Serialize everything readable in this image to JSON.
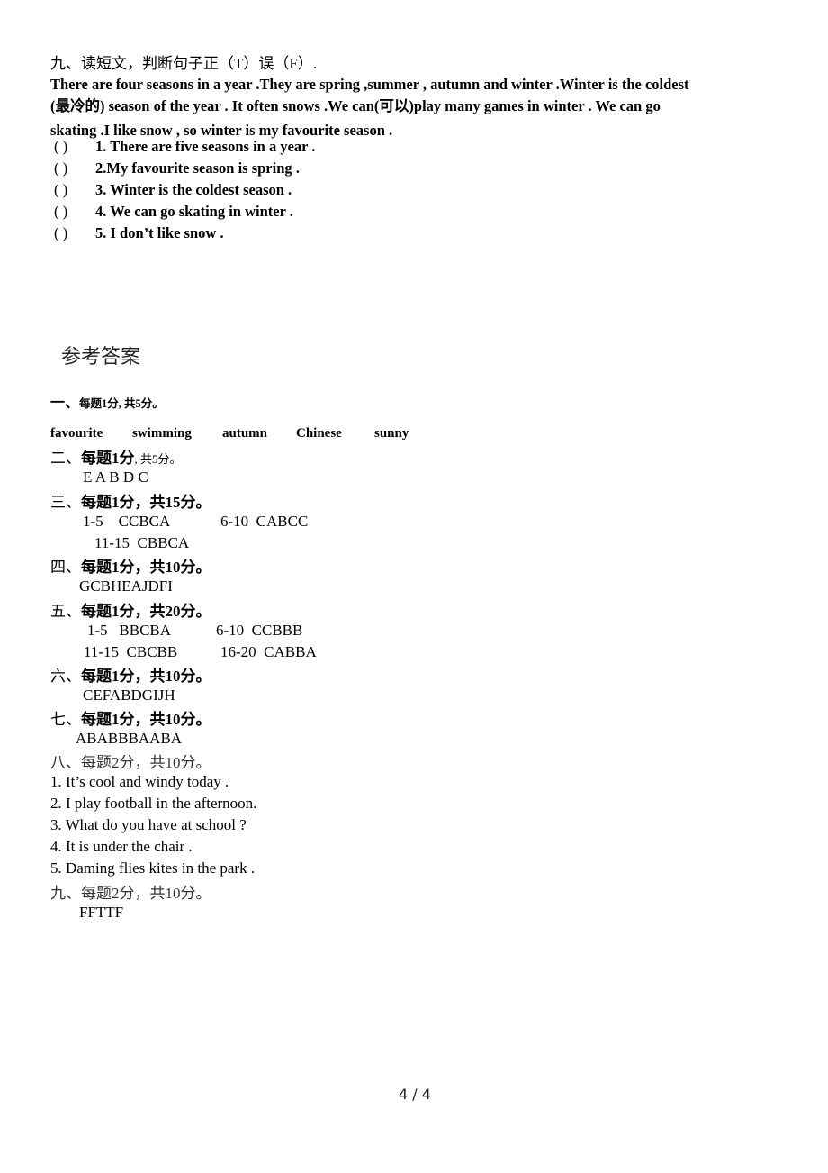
{
  "exercise9": {
    "heading": "九、读短文，判断句子正（T）误（F）.",
    "passage_line1": "There are four seasons in a year .They are spring ,summer , autumn and winter .Winter is the coldest",
    "passage_line2": "(最冷的) season of the year . It often snows .We can(可以)play many games in winter . We can go",
    "passage_line3": "skating .I like snow , so winter is my favourite season .",
    "answer_blank": "(    )",
    "questions": [
      "1. There are five seasons in a year .",
      "2.My favourite season is spring .",
      "3. Winter is the coldest season  .",
      "4. We can go skating in winter .",
      "5. I don’t like snow ."
    ]
  },
  "answer_key": {
    "title": "参考答案",
    "sections": [
      {
        "num": "一、",
        "score": "每题1分, 共5分。",
        "answers": [
          "favourite",
          "swimming",
          "autumn",
          "Chinese",
          "sunny"
        ]
      },
      {
        "num": "二、",
        "score_bold": "每题1分",
        "score_rest": ", 共5分。",
        "answers": [
          "E A B D C"
        ]
      },
      {
        "num": "三、",
        "score": "每题1分，共15分。",
        "answers": [
          "1-5    CCBCA",
          "6-10  CABCC",
          "11-15  CBBCA"
        ]
      },
      {
        "num": "四、",
        "score": "每题1分，共10分。",
        "answers": [
          "GCBHEAJDFI"
        ]
      },
      {
        "num": "五、",
        "score": "每题1分，共20分。",
        "answers": [
          "1-5   BBCBA",
          "6-10  CCBBB",
          "11-15  CBCBB",
          "16-20  CABBA"
        ]
      },
      {
        "num": "六、",
        "score": "每题1分，共10分。",
        "answers": [
          "CEFABDGIJH"
        ]
      },
      {
        "num": "七、",
        "score": "每题1分，共10分。",
        "answers": [
          "ABABBBAABA"
        ]
      },
      {
        "num": "八、",
        "score": "每题2分，共10分。",
        "answers": [
          "1. It’s cool and windy today .",
          "2. I play football in the afternoon.",
          "3. What do you have at school ?",
          "4. It is under the chair .",
          "5. Daming flies kites in the park ."
        ]
      },
      {
        "num": "九、",
        "score": "每题2分，共10分。",
        "answers": [
          "FFTTF"
        ]
      }
    ]
  },
  "footer": {
    "page_number": "4 / 4"
  }
}
